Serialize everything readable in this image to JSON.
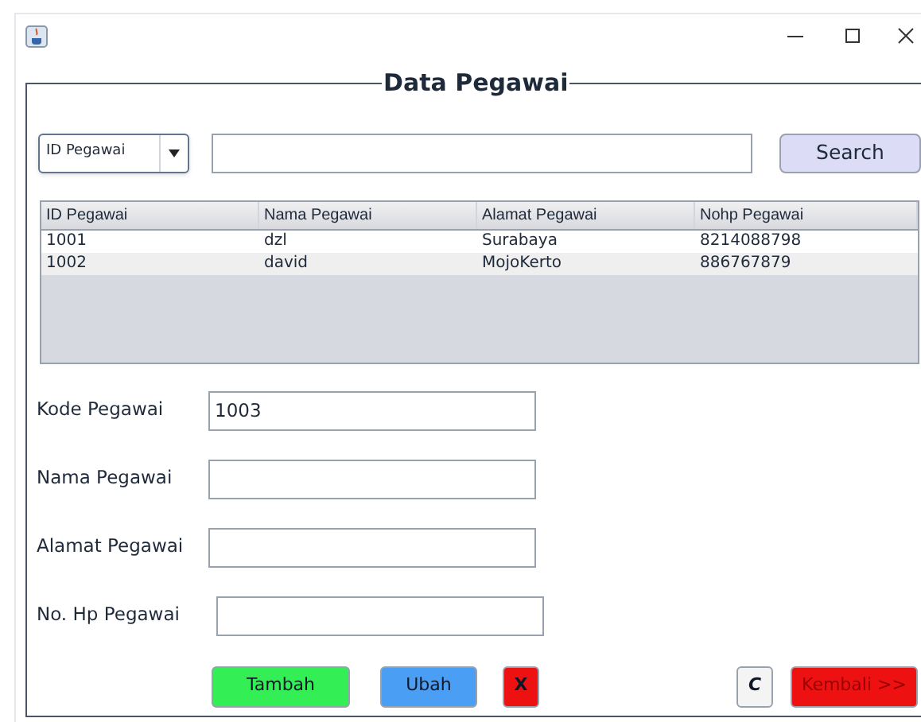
{
  "window": {
    "title": "Data Pegawai"
  },
  "search": {
    "filter": "ID Pegawai",
    "button": "Search"
  },
  "table": {
    "columns": [
      "ID Pegawai",
      "Nama Pegawai",
      "Alamat Pegawai",
      "Nohp Pegawai"
    ],
    "rows": [
      [
        "1001",
        "dzl",
        "Surabaya",
        "8214088798"
      ],
      [
        "1002",
        "david",
        "MojoKerto",
        "886767879"
      ]
    ]
  },
  "form": [
    {
      "label": "Kode Pegawai",
      "value": "1003"
    },
    {
      "label": "Nama Pegawai"
    },
    {
      "label": "Alamat Pegawai"
    },
    {
      "label": "No. Hp Pegawai"
    }
  ],
  "buttons": [
    {
      "label": "Tambah",
      "color": "#33ee55"
    },
    {
      "label": "Ubah",
      "color": "#4a9ff5"
    },
    {
      "label": "X",
      "color": "#ee1111"
    },
    {
      "label": "C",
      "color": "#f4f4f4"
    },
    {
      "label": "Kembali >>",
      "color": "#ee1111"
    }
  ]
}
